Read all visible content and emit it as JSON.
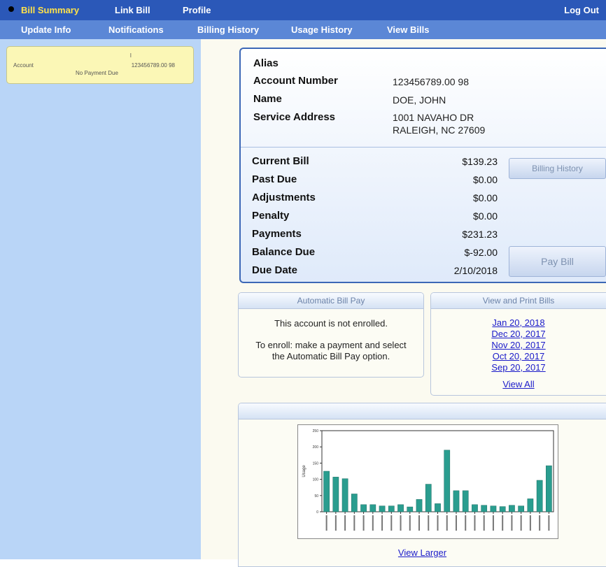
{
  "nav": {
    "row1": [
      {
        "label": "Bill Summary",
        "active": true
      },
      {
        "label": "Link Bill"
      },
      {
        "label": "Profile"
      }
    ],
    "logout": "Log Out",
    "row2": [
      {
        "label": "Update Info"
      },
      {
        "label": "Notifications"
      },
      {
        "label": "Billing History"
      },
      {
        "label": "Usage History"
      },
      {
        "label": "View Bills"
      }
    ]
  },
  "sidebar": {
    "account": {
      "label": "Account",
      "number": "123456789.00 98",
      "marker": "I",
      "status": "No Payment Due"
    }
  },
  "account_info": {
    "alias_label": "Alias",
    "account_number_label": "Account Number",
    "account_number": "123456789.00 98",
    "name_label": "Name",
    "name": "DOE, JOHN",
    "service_address_label": "Service Address",
    "address_line1": "1001 NAVAHO DR",
    "address_line2": "RALEIGH, NC 27609"
  },
  "bill": {
    "rows": [
      {
        "label": "Current Bill",
        "value": "$139.23"
      },
      {
        "label": "Past Due",
        "value": "$0.00"
      },
      {
        "label": "Adjustments",
        "value": "$0.00"
      },
      {
        "label": "Penalty",
        "value": "$0.00"
      },
      {
        "label": "Payments",
        "value": "$231.23"
      },
      {
        "label": "Balance Due",
        "value": "$-92.00"
      },
      {
        "label": "Due Date",
        "value": "2/10/2018"
      }
    ],
    "billing_history_button": "Billing History",
    "pay_bill_button": "Pay Bill"
  },
  "auto_pay": {
    "title": "Automatic Bill Pay",
    "status": "This account is not enrolled.",
    "instructions": "To enroll: make a payment and select the Automatic Bill Pay option."
  },
  "view_bills": {
    "title": "View and Print Bills",
    "links": [
      "Jan 20, 2018",
      "Dec 20, 2017",
      "Nov 20, 2017",
      "Oct 20, 2017",
      "Sep 20, 2017"
    ],
    "view_all": "View All"
  },
  "usage": {
    "view_larger": "View Larger",
    "chart_data": {
      "type": "bar",
      "ylabel": "Usage",
      "ylim": [
        0,
        250
      ],
      "values": [
        125,
        107,
        102,
        55,
        22,
        22,
        18,
        18,
        22,
        15,
        38,
        85,
        25,
        190,
        65,
        65,
        22,
        20,
        18,
        16,
        20,
        18,
        40,
        97,
        142
      ],
      "bar_color": "#2a9d8f"
    }
  }
}
